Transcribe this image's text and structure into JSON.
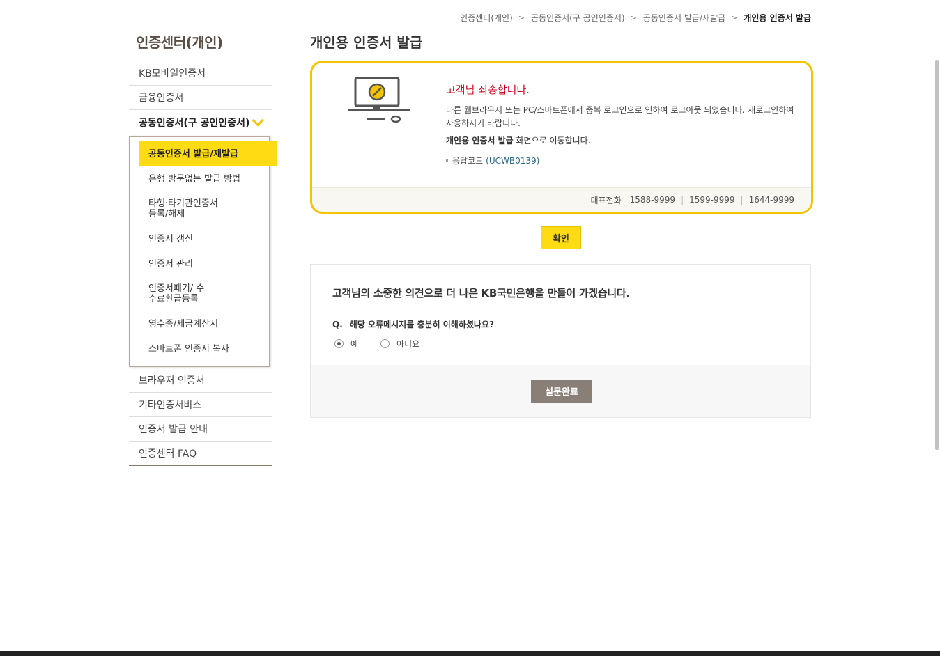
{
  "breadcrumb": {
    "items": [
      "인증센터(개인)",
      "공동인증서(구 공인인증서)",
      "공동인증서 발급/재발급",
      "개인용 인증서 발급"
    ],
    "separator": ">"
  },
  "sidebar": {
    "title": "인증센터(개인)",
    "items_before": [
      "KB모바일인증서",
      "금융인증서"
    ],
    "open_item": "공동인증서(구 공인인증서)",
    "sub_items": [
      "공동인증서 발급/재발급",
      "은행 방문없는 발급 방법",
      "타행·타기관인증서 등록/해제",
      "인증서 갱신",
      "인증서 관리",
      "인증서폐기/ 수수료환급등록",
      "영수증/세금계산서",
      "스마트폰 인증서 복사"
    ],
    "items_after": [
      "브라우저 인증서",
      "기타인증서비스",
      "인증서 발급 안내",
      "인증센터 FAQ"
    ]
  },
  "main": {
    "title": "개인용 인증서 발급",
    "alert": {
      "title": "고객님 죄송합니다.",
      "message": "다른 웹브라우저 또는 PC/스마트폰에서 중복 로그인으로 인하여 로그아웃 되었습니다. 재로그인하여 사용하시기 바랍니다.",
      "redirect_bold": "개인용 인증서 발급",
      "redirect_rest": " 화면으로 이동합니다.",
      "code_label": "응답코드",
      "code_value": "(UCWB0139)",
      "phone_label": "대표전화",
      "phones": [
        "1588-9999",
        "1599-9999",
        "1644-9999"
      ],
      "phone_sep": "|"
    },
    "confirm_label": "확인",
    "survey": {
      "title": "고객님의 소중한 의견으로 더 나은 KB국민은행을 만들어 가겠습니다.",
      "q_mark": "Q.",
      "question": "해당 오류메시지를 충분히 이해하셨나요?",
      "options": [
        "예",
        "아니요"
      ],
      "selected": "예",
      "submit_label": "설문완료"
    }
  },
  "colors": {
    "accent": "#ffdb13",
    "alert_border": "#f5c400",
    "alert_title": "#d0021b",
    "submit_btn": "#8a7f76"
  }
}
